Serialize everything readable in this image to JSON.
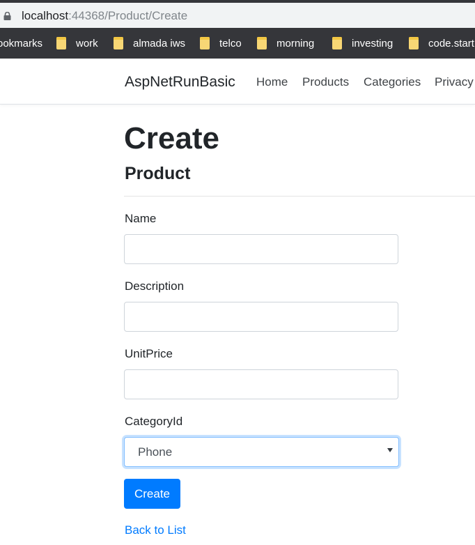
{
  "browser": {
    "url_host": "localhost",
    "url_rest": ":44368/Product/Create",
    "bookmarks": [
      {
        "label": "ookmarks",
        "folder": false
      },
      {
        "label": "work",
        "folder": true
      },
      {
        "label": "almada iws",
        "folder": true
      },
      {
        "label": "telco",
        "folder": true
      },
      {
        "label": "morning",
        "folder": true
      },
      {
        "label": "investing",
        "folder": true
      },
      {
        "label": "code.start",
        "folder": true
      }
    ]
  },
  "navbar": {
    "brand": "AspNetRunBasic",
    "links": [
      "Home",
      "Products",
      "Categories",
      "Privacy"
    ]
  },
  "page": {
    "title": "Create",
    "subtitle": "Product"
  },
  "form": {
    "name": {
      "label": "Name",
      "value": ""
    },
    "description": {
      "label": "Description",
      "value": ""
    },
    "unit_price": {
      "label": "UnitPrice",
      "value": ""
    },
    "category": {
      "label": "CategoryId",
      "selected": "Phone"
    },
    "submit_label": "Create"
  },
  "back_link": "Back to List",
  "colors": {
    "primary": "#007bff",
    "bookmark_bar": "#35363a",
    "folder": "#f8d775"
  }
}
